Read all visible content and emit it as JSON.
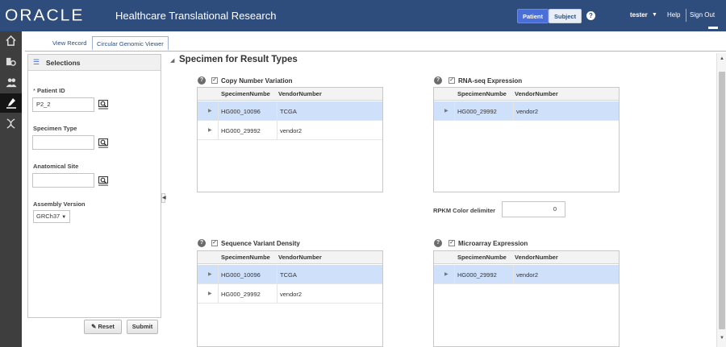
{
  "header": {
    "logo": "ORACLE",
    "title": "Healthcare Translational Research",
    "patient_label": "Patient",
    "subject_label": "Subject",
    "user": "tester",
    "help": "Help",
    "sign_out": "Sign Out"
  },
  "tabs": [
    {
      "label": "View Record"
    },
    {
      "label": "Circular Genomic Viewer"
    }
  ],
  "selections": {
    "title": "Selections",
    "patient_id_label": "Patient ID",
    "patient_id_required": "*",
    "patient_id_value": "P2_2",
    "specimen_type_label": "Specimen Type",
    "specimen_type_value": "",
    "anatomical_site_label": "Anatomical Site",
    "anatomical_site_value": "",
    "assembly_label": "Assembly Version",
    "assembly_value": "GRCh37",
    "reset_label": "Reset",
    "submit_label": "Submit"
  },
  "main": {
    "section_title": "Specimen for Result Types",
    "col1": "SpecimenNumbe",
    "col2": "VendorNumber",
    "groups": [
      {
        "title": "Copy Number Variation",
        "rows": [
          [
            "HG000_10096",
            "TCGA"
          ],
          [
            "HG000_29992",
            "vendor2"
          ]
        ]
      },
      {
        "title": "RNA-seq Expression",
        "rows": [
          [
            "HG000_29992",
            "vendor2"
          ]
        ]
      },
      {
        "title": "Sequence Variant Density",
        "rows": [
          [
            "HG000_10096",
            "TCGA"
          ],
          [
            "HG000_29992",
            "vendor2"
          ]
        ]
      },
      {
        "title": "Microarray Expression",
        "rows": [
          [
            "HG000_29992",
            "vendor2"
          ]
        ]
      }
    ],
    "rpkm_label": "RPKM Color delimiter",
    "rpkm_value": "0"
  },
  "colors": {
    "header_bg": "#2f4d7c",
    "selected_row": "#cfe0fb",
    "patient_button": "#4a6fd8"
  }
}
